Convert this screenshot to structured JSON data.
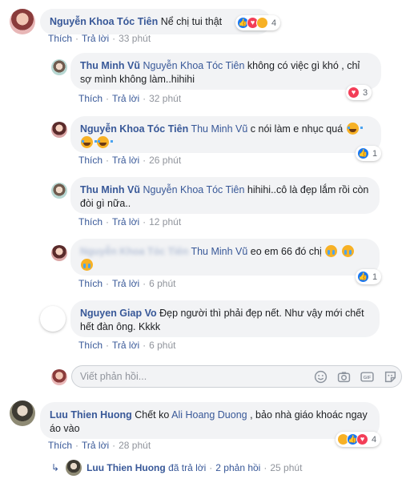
{
  "actions": {
    "like": "Thích",
    "reply": "Trả lời",
    "sep": "·"
  },
  "comments": [
    {
      "author": "Nguyễn Khoa Tóc Tiên",
      "text": "Nể chị tui thật",
      "time": "33 phút",
      "reaction_count": "4"
    },
    {
      "author": "Thu Minh Vũ",
      "mention": "Nguyễn Khoa Tóc Tiên",
      "text": " không có việc gì khó , chỉ sợ mình không làm..hihihi",
      "time": "32 phút",
      "reaction_count": "3"
    },
    {
      "author": "Nguyễn Khoa Tóc Tiên",
      "mention": "Thu Minh Vũ",
      "text": " c nói làm e nhục quá",
      "time": "26 phút",
      "reaction_count": "1"
    },
    {
      "author": "Thu Minh Vũ",
      "mention": "Nguyễn Khoa Tóc Tiên",
      "text": " hihihi..cô là đẹp lắm rồi còn đòi gì nữa..",
      "time": "12 phút"
    },
    {
      "author_blurred": "Nguyễn Khoa Tóc Tiên",
      "mention": "Thu Minh Vũ",
      "text": " eo em 66 đó chị",
      "time": "6 phút",
      "reaction_count": "1"
    },
    {
      "author": "Nguyen Giap Vo",
      "text": " Đẹp người thì phải đẹp nết. Như vậy mới chết hết đàn ông. Kkkk",
      "time": "6 phút"
    },
    {
      "author": "Luu Thien Huong",
      "text": " Chết ko ",
      "mention": "Ali Hoang Duong",
      "text2": " , bảo nhà giáo khoác ngay áo vào",
      "time": "28 phút",
      "reaction_count": "4"
    }
  ],
  "reply_input": {
    "placeholder": "Viết phản hồi..."
  },
  "more_replies": {
    "author": "Luu Thien Huong",
    "verb": "đã trả lời",
    "count": "2 phản hồi",
    "time": "25 phút"
  },
  "colors": {
    "link": "#385898",
    "bubble": "#f2f3f5",
    "meta": "#90949c"
  }
}
